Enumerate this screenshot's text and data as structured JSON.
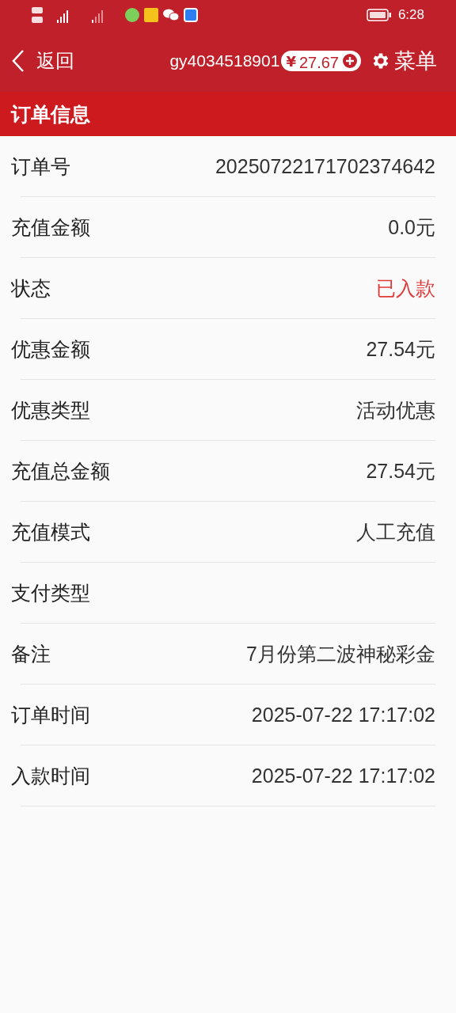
{
  "status_bar": {
    "time": "6:28"
  },
  "header": {
    "back": "返回",
    "username": "gy4034518901",
    "currency": "¥",
    "balance": "27.67",
    "menu": "菜单"
  },
  "section": {
    "title": "订单信息"
  },
  "rows": [
    {
      "label": "订单号",
      "value": "20250722171702374642",
      "kind": "normal"
    },
    {
      "label": "充值金额",
      "value": "0.0元",
      "kind": "normal"
    },
    {
      "label": "状态",
      "value": "已入款",
      "kind": "status"
    },
    {
      "label": "优惠金额",
      "value": "27.54元",
      "kind": "normal"
    },
    {
      "label": "优惠类型",
      "value": "活动优惠",
      "kind": "normal"
    },
    {
      "label": "充值总金额",
      "value": "27.54元",
      "kind": "normal"
    },
    {
      "label": "充值模式",
      "value": "人工充值",
      "kind": "normal"
    },
    {
      "label": "支付类型",
      "kind": "normal"
    },
    {
      "label": "备注",
      "value": "7月份第二波神秘彩金",
      "kind": "normal"
    },
    {
      "label": "订单时间",
      "value": "2025-07-22 17:17:02",
      "kind": "normal"
    },
    {
      "label": "入款时间",
      "value": "2025-07-22 17:17:02",
      "kind": "normal"
    }
  ]
}
